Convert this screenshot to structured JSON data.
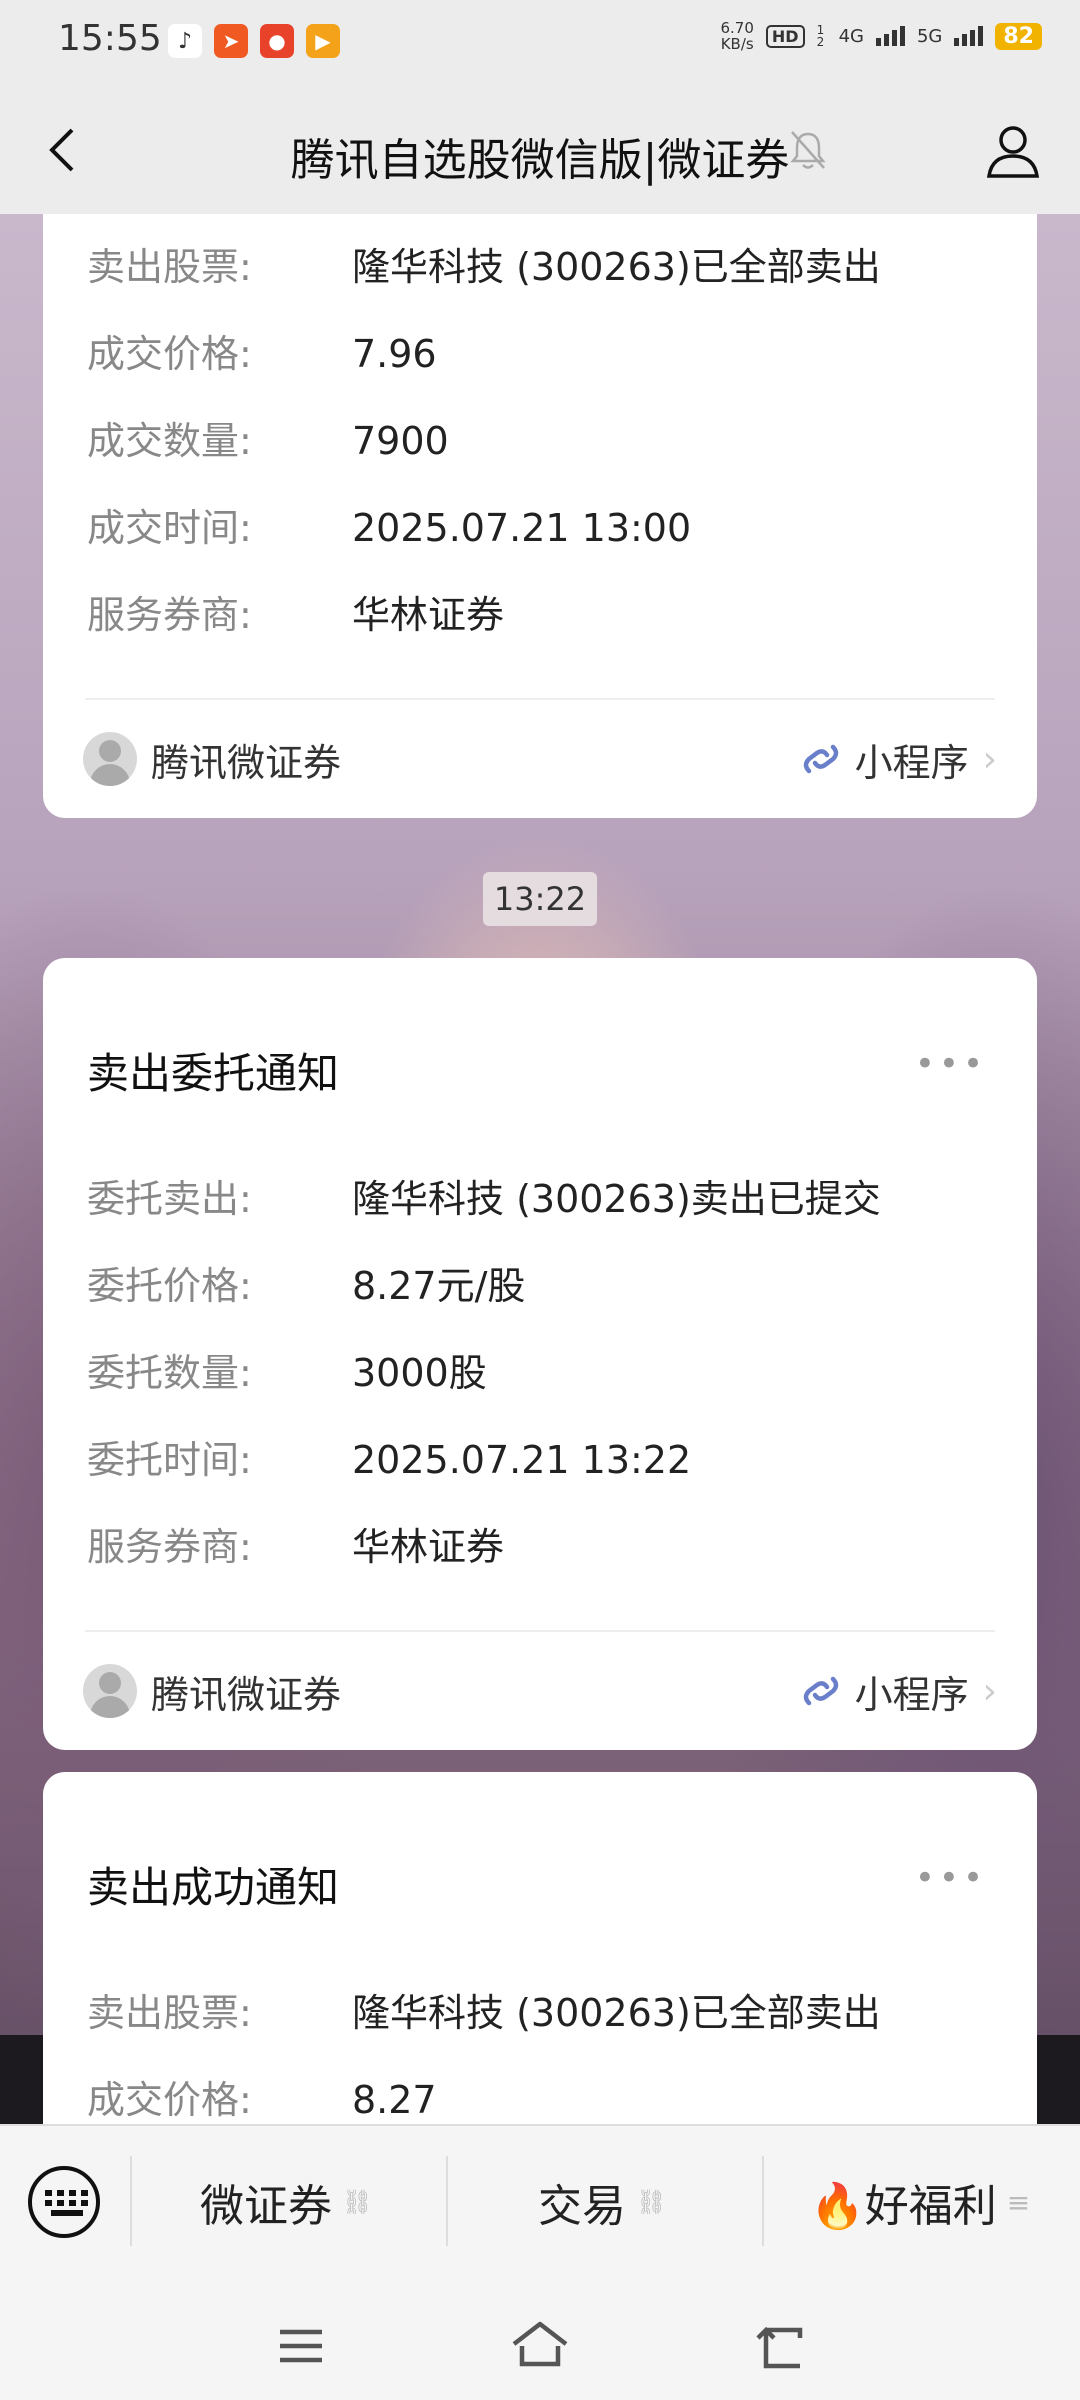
{
  "status_bar": {
    "time": "15:55",
    "net_speed_value": "6.70",
    "net_speed_unit": "KB/s",
    "hd_label": "HD",
    "hd_sub": "1 2",
    "net1": "4G",
    "net2": "5G",
    "battery": "82"
  },
  "header": {
    "title": "腾讯自选股微信版|微证券"
  },
  "card1": {
    "rows": [
      {
        "label": "卖出股票:",
        "value": "隆华科技 (300263)已全部卖出"
      },
      {
        "label": "成交价格:",
        "value": "7.96"
      },
      {
        "label": "成交数量:",
        "value": "7900"
      },
      {
        "label": "成交时间:",
        "value": "2025.07.21 13:00"
      },
      {
        "label": "服务券商:",
        "value": "华林证券"
      }
    ],
    "source": "腾讯微证券",
    "mini_program": "小程序"
  },
  "timestamp": "13:22",
  "card2": {
    "title": "卖出委托通知",
    "more": "•••",
    "rows": [
      {
        "label": "委托卖出:",
        "value": "隆华科技 (300263)卖出已提交"
      },
      {
        "label": "委托价格:",
        "value": "8.27元/股"
      },
      {
        "label": "委托数量:",
        "value": "3000股"
      },
      {
        "label": "委托时间:",
        "value": "2025.07.21 13:22"
      },
      {
        "label": "服务券商:",
        "value": "华林证券"
      }
    ],
    "source": "腾讯微证券",
    "mini_program": "小程序"
  },
  "card3": {
    "title": "卖出成功通知",
    "more": "•••",
    "rows": [
      {
        "label": "卖出股票:",
        "value": "隆华科技 (300263)已全部卖出"
      },
      {
        "label": "成交价格:",
        "value": "8.27"
      }
    ]
  },
  "bottom_menu": {
    "items": [
      {
        "label": "微证券"
      },
      {
        "label": "交易"
      },
      {
        "label": "🔥好福利"
      }
    ]
  },
  "colors": {
    "battery": "#f2b300",
    "link_icon": "#6a7fc9",
    "card_bg": "#ffffff"
  }
}
